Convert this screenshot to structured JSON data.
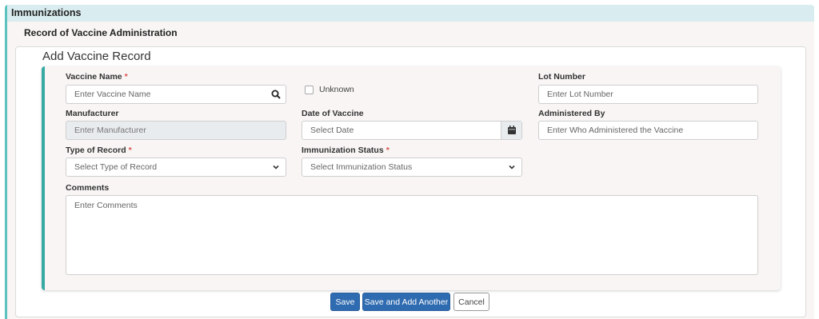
{
  "panel": {
    "title": "Immunizations"
  },
  "section": {
    "title": "Record of Vaccine Administration"
  },
  "card": {
    "title": "Add Vaccine Record"
  },
  "form": {
    "vaccine_name": {
      "label": "Vaccine Name",
      "placeholder": "Enter Vaccine Name",
      "required": "*"
    },
    "unknown": {
      "label": "Unknown"
    },
    "lot_number": {
      "label": "Lot Number",
      "placeholder": "Enter Lot Number"
    },
    "manufacturer": {
      "label": "Manufacturer",
      "placeholder": "Enter Manufacturer"
    },
    "date_of_vaccine": {
      "label": "Date of Vaccine",
      "placeholder": "Select Date"
    },
    "administered_by": {
      "label": "Administered By",
      "placeholder": "Enter Who Administered the Vaccine"
    },
    "type_of_record": {
      "label": "Type of Record",
      "placeholder": "Select Type of Record",
      "required": "*"
    },
    "immunization_status": {
      "label": "Immunization Status",
      "placeholder": "Select Immunization Status",
      "required": "*"
    },
    "comments": {
      "label": "Comments",
      "placeholder": "Enter Comments"
    }
  },
  "buttons": {
    "save": "Save",
    "save_add": "Save and Add Another",
    "cancel": "Cancel"
  },
  "colors": {
    "accent": "#36a9a3",
    "header_bg": "#d9ecef",
    "primary": "#2f6bb0",
    "required": "#d9534f"
  },
  "icons": {
    "search": "search-icon",
    "calendar": "calendar-icon",
    "chevron": "chevron-down-icon"
  }
}
